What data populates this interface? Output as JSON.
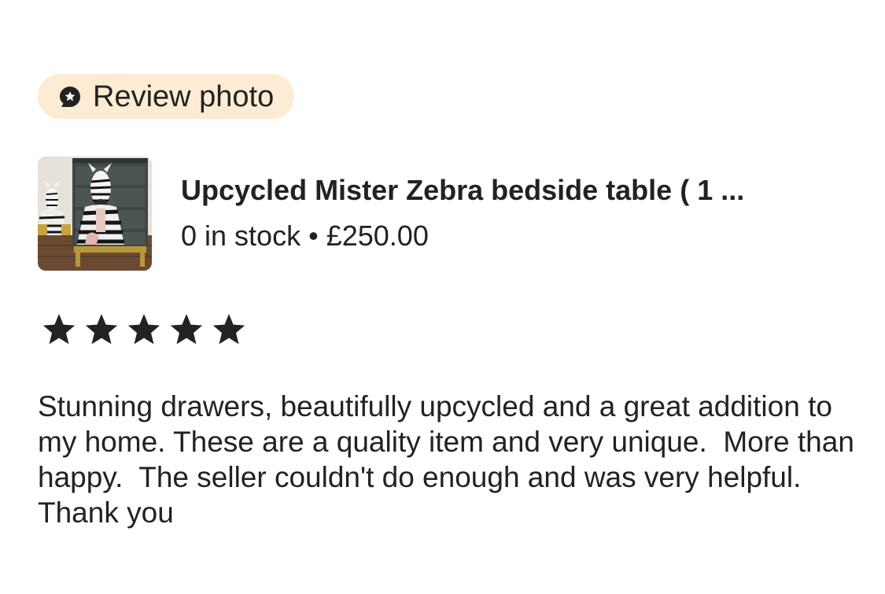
{
  "badge": {
    "label": "Review photo",
    "icon": "star-badge-icon",
    "background": "#fdebd3"
  },
  "listing": {
    "title": "Upcycled Mister Zebra bedside table ( 1 ...",
    "stock": "0 in stock",
    "separator": "•",
    "price": "£250.00",
    "thumbnail": "zebra-drawers-thumbnail"
  },
  "rating": {
    "stars": 5,
    "max": 5,
    "star_color": "#222222"
  },
  "review": {
    "text": "Stunning drawers, beautifully upcycled and a great addition to my home. These are a quality item and very unique.  More than happy.  The seller couldn't do enough and was very helpful. Thank you"
  }
}
